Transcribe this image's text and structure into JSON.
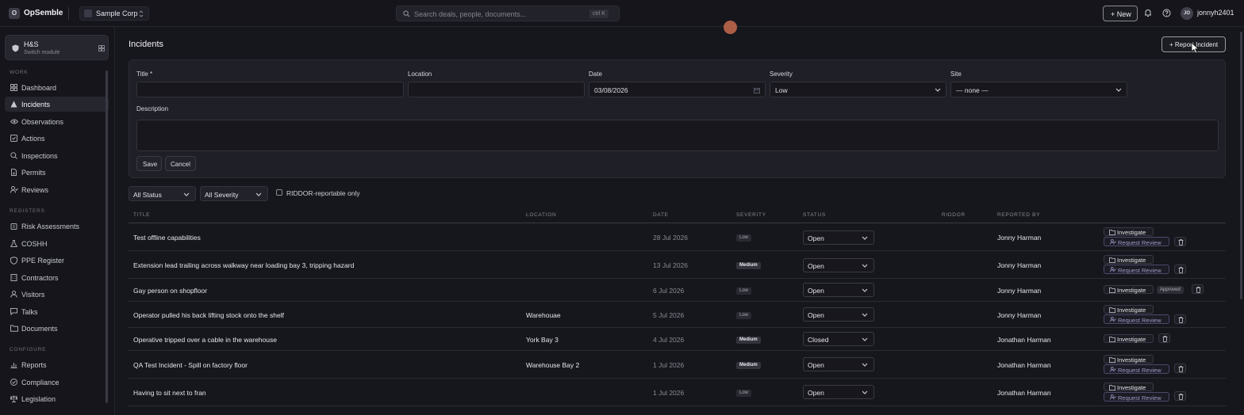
{
  "app": {
    "logo_letter": "O",
    "name": "OpSemble"
  },
  "org": {
    "name": "Sample Corp"
  },
  "search": {
    "placeholder": "Search deals, people, documents...",
    "shortcut": "ctrl K"
  },
  "topbar": {
    "new_label": "+ New",
    "avatar_initials": "JO",
    "username": "jonnyh2401"
  },
  "module": {
    "title": "H&S",
    "subtitle": "Switch module"
  },
  "sidebar": {
    "sections": [
      "WORK",
      "REGISTERS",
      "CONFIGURE"
    ],
    "work": [
      "Dashboard",
      "Incidents",
      "Observations",
      "Actions",
      "Inspections",
      "Permits",
      "Reviews"
    ],
    "registers": [
      "Risk Assessments",
      "COSHH",
      "PPE Register",
      "Contractors",
      "Visitors",
      "Talks",
      "Documents"
    ],
    "configure": [
      "Reports",
      "Compliance",
      "Legislation"
    ],
    "active": "Incidents"
  },
  "page": {
    "title": "Incidents",
    "report_button": "+ Report Incident"
  },
  "form": {
    "title_label": "Title *",
    "title_value": "",
    "location_label": "Location",
    "location_value": "",
    "date_label": "Date",
    "date_value": "03/08/2026",
    "severity_label": "Severity",
    "severity_value": "Low",
    "site_label": "Site",
    "site_value": "— none —",
    "description_label": "Description",
    "description_value": "",
    "save_label": "Save",
    "cancel_label": "Cancel"
  },
  "filters": {
    "status": "All Status",
    "severity": "All Severity",
    "riddor_label": "RIDDOR-reportable only",
    "riddor_checked": false
  },
  "table": {
    "headers": [
      "TITLE",
      "LOCATION",
      "DATE",
      "SEVERITY",
      "STATUS",
      "RIDDOR",
      "REPORTED BY"
    ],
    "investigate_label": "Investigate",
    "review_label": "Request Review",
    "approved_label": "Approved",
    "rows": [
      {
        "title": "Test offline capabilities",
        "location": "",
        "date": "28 Jul 2026",
        "severity": "Low",
        "status": "Open",
        "reported_by": "Jonny Harman"
      },
      {
        "title": "Extension lead trailing across walkway near loading bay 3, tripping hazard",
        "location": "",
        "date": "13 Jul 2026",
        "severity": "Medium",
        "status": "Open",
        "reported_by": "Jonny Harman"
      },
      {
        "title": "Gay person on shopfloor",
        "location": "",
        "date": "6 Jul 2026",
        "severity": "Low",
        "status": "Open",
        "reported_by": "Jonny Harman",
        "approved": true
      },
      {
        "title": "Operator pulled his back lifting stock onto the shelf",
        "location": "Warehouae",
        "date": "5 Jul 2026",
        "severity": "Low",
        "status": "Open",
        "reported_by": "Jonny Harman"
      },
      {
        "title": "Operative tripped over a cable in the warehouse",
        "location": "York Bay 3",
        "date": "4 Jul 2026",
        "severity": "Medium",
        "status": "Closed",
        "reported_by": "Jonathan Harman"
      },
      {
        "title": "QA Test Incident - Spill on factory floor",
        "location": "Warehouse Bay 2",
        "date": "1 Jul 2026",
        "severity": "Medium",
        "status": "Open",
        "reported_by": "Jonathan Harman"
      },
      {
        "title": "Having to sit next to fran",
        "location": "",
        "date": "1 Jul 2026",
        "severity": "Low",
        "status": "Open",
        "reported_by": "Jonathan Harman"
      }
    ]
  }
}
